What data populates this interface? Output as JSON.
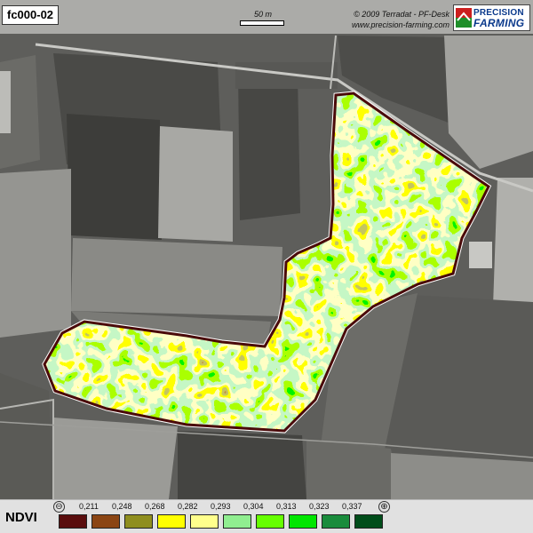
{
  "map": {
    "id": "fc000-02",
    "scale_label": "50 m",
    "copyright_line1": "© 2009 Terradat - PF-Desk",
    "copyright_line2": "www.precision-farming.com",
    "logo_line1": "PRECISION",
    "logo_line2": "FARMING"
  },
  "legend": {
    "title": "NDVI",
    "low_symbol": "⊖",
    "high_symbol": "⊕",
    "breaks": [
      "0,211",
      "0,248",
      "0,268",
      "0,282",
      "0,293",
      "0,304",
      "0,313",
      "0,323",
      "0,337"
    ],
    "classes": [
      "#5a0d0d",
      "#8b4513",
      "#8f8e1e",
      "#ffff00",
      "#ffff8c",
      "#90ee90",
      "#66ff00",
      "#00e600",
      "#1a8c3c",
      "#004d1a"
    ]
  }
}
